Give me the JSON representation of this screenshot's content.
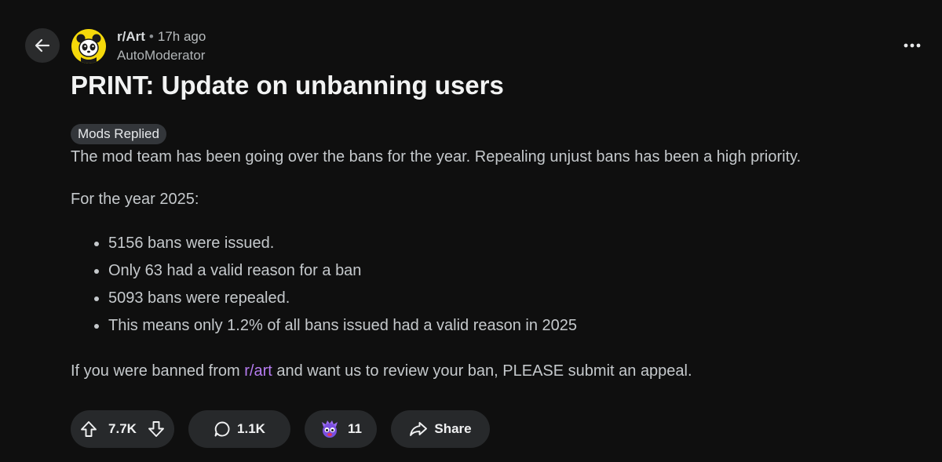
{
  "post": {
    "subreddit": "r/Art",
    "separator": "•",
    "time_ago": "17h ago",
    "author": "AutoModerator",
    "title": "PRINT: Update on unbanning users",
    "flair": "Mods Replied",
    "body": {
      "intro": "The mod team has been going over the bans for the year. Repealing unjust bans has been a high priority.",
      "year_heading": "For the year 2025:",
      "bullets": [
        "5156 bans were issued.",
        "Only 63 had a valid reason for a ban",
        "5093 bans were repealed.",
        "This means only 1.2% of all bans issued had a valid reason in 2025"
      ],
      "appeal_before": "If you were banned from ",
      "appeal_link": "r/art",
      "appeal_after": " and want us to review your ban, PLEASE submit an appeal."
    }
  },
  "actions": {
    "votes": "7.7K",
    "comments": "1.1K",
    "awards": "11",
    "share_label": "Share"
  },
  "icons": {
    "back": "arrow-left-icon",
    "more": "more-horizontal-icon",
    "upvote": "upvote-arrow-icon",
    "downvote": "downvote-arrow-icon",
    "comment": "comment-bubble-icon",
    "award": "award-icon",
    "share": "share-arrow-icon"
  },
  "colors": {
    "background": "#0f0f0f",
    "link": "#b67cf0",
    "avatar_bg": "#f5d90a",
    "pill_bg": "#27292b"
  }
}
